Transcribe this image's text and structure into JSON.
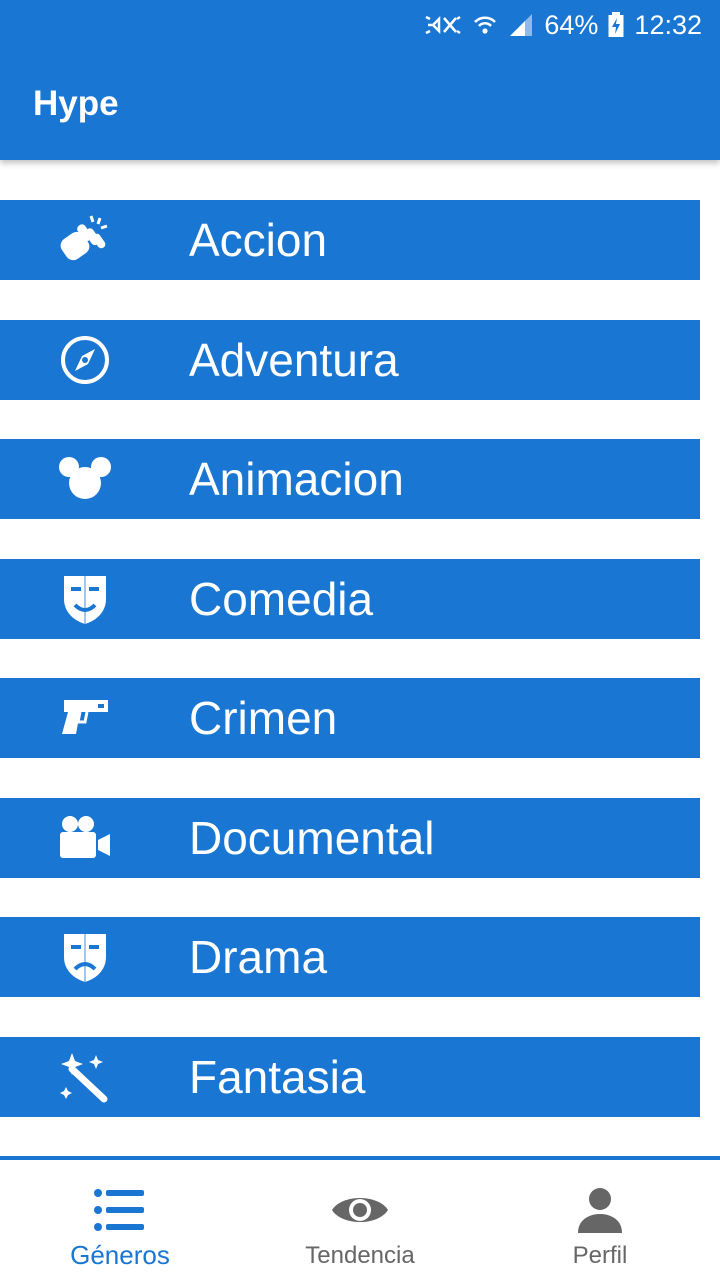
{
  "status_bar": {
    "battery": "64%",
    "time": "12:32",
    "icons": [
      "mute-icon",
      "wifi-icon",
      "signal-icon",
      "battery-icon"
    ]
  },
  "app_bar": {
    "title": "Hype"
  },
  "genres": [
    {
      "label": "Accion",
      "icon": "fist-icon"
    },
    {
      "label": "Adventura",
      "icon": "compass-icon"
    },
    {
      "label": "Animacion",
      "icon": "mouse-ears-icon"
    },
    {
      "label": "Comedia",
      "icon": "theater-mask-icon"
    },
    {
      "label": "Crimen",
      "icon": "pistol-icon"
    },
    {
      "label": "Documental",
      "icon": "video-camera-icon"
    },
    {
      "label": "Drama",
      "icon": "theater-mask-icon"
    },
    {
      "label": "Fantasia",
      "icon": "magic-wand-icon"
    }
  ],
  "bottom_nav": {
    "items": [
      {
        "label": "Géneros",
        "icon": "list-icon",
        "active": true
      },
      {
        "label": "Tendencia",
        "icon": "eye-icon",
        "active": false
      },
      {
        "label": "Perfil",
        "icon": "person-icon",
        "active": false
      }
    ]
  },
  "colors": {
    "primary": "#1976d2",
    "inactive_nav": "#666666",
    "background": "#ffffff"
  }
}
